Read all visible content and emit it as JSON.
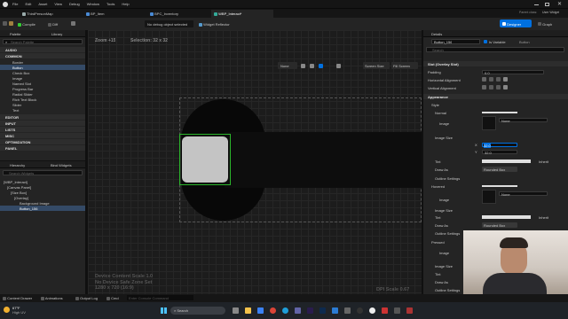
{
  "menu": {
    "items": [
      "File",
      "Edit",
      "Asset",
      "View",
      "Debug",
      "Window",
      "Tools",
      "Help"
    ]
  },
  "tabs": [
    "ThirdPersonMap",
    "BP_Item",
    "BPC_Inventory",
    "WBP_Interact*"
  ],
  "window_controls": {
    "parent_class": "Parent class:",
    "parent_value": "User Widget",
    "designer": "Designer",
    "graph": "Graph"
  },
  "toolbar": {
    "compile": "Compile",
    "diff": "Diff",
    "debug_select": "No debug object selected",
    "widget_reflector": "Widget Reflector"
  },
  "palette": {
    "title": "Palette",
    "library": "Library",
    "search_placeholder": "Search Palette",
    "sections": [
      {
        "name": "AUDIO",
        "items": []
      },
      {
        "name": "COMMON",
        "items": [
          "Border",
          "Button",
          "Check Box",
          "Image",
          "Named Slot",
          "Progress Bar",
          "Radial Slider",
          "Rich Text Block",
          "Slider",
          "Text"
        ]
      },
      {
        "name": "EDITOR",
        "items": []
      },
      {
        "name": "INPUT",
        "items": []
      },
      {
        "name": "LISTS",
        "items": []
      },
      {
        "name": "MISC",
        "items": []
      },
      {
        "name": "OPTIMIZATION",
        "items": []
      },
      {
        "name": "PANEL",
        "items": []
      }
    ]
  },
  "hierarchy": {
    "title": "Hierarchy",
    "bind": "Bind Widgets",
    "search_placeholder": "Search Widgets",
    "items": [
      "[WBP_Interact]",
      "[Canvas Panel]",
      "[Size Box]",
      "[Overlay]",
      "Background Image",
      "Button_156"
    ]
  },
  "viewport": {
    "zoom": "Zoom +15",
    "selection": "Selection: 32 x 32",
    "none_btn": "None",
    "screen_size": "Screen Size",
    "fill_screen": "Fill Screen",
    "content_scale": "Device Content Scale 1.0",
    "safe_zone": "No Device Safe Zone Set",
    "resolution": "1280 x 720 (16:9)",
    "dpi": "DPI Scale 0.67"
  },
  "details": {
    "title": "Details",
    "name_value": "Button_156",
    "is_variable": "Is Variable",
    "type": "Button",
    "search_placeholder": "Search",
    "sections": [
      "Slot (Overlay Slot)",
      "Appearance",
      "Style"
    ],
    "rows": {
      "padding": "Padding",
      "padding_value": "0.0",
      "h_align": "Horizontal Alignment",
      "v_align": "Vertical Alignment",
      "normal": "Normal",
      "image": "Image",
      "none": "None",
      "image_size": "Image Size",
      "x": "X",
      "y": "Y",
      "x_value": "32.0",
      "y_value": "32.0",
      "tint": "Tint",
      "draw_as": "Draw As",
      "draw_value": "Rounded Box",
      "outline": "Outline Settings",
      "hovered": "Hovered",
      "pressed": "Pressed",
      "inherit": "Inherit"
    }
  },
  "statusbar": {
    "content_drawer": "Content Drawer",
    "animations": "Animations",
    "output_log": "Output Log",
    "cmd": "Cmd",
    "console_placeholder": "Enter Console Command"
  },
  "taskbar": {
    "temp": "67°F",
    "weather": "High UV",
    "search": "Search"
  },
  "colors": {
    "accent": "#0070e0",
    "selection": "#2bb52b",
    "canvas": "#1c1c1c",
    "panel": "#242424"
  }
}
